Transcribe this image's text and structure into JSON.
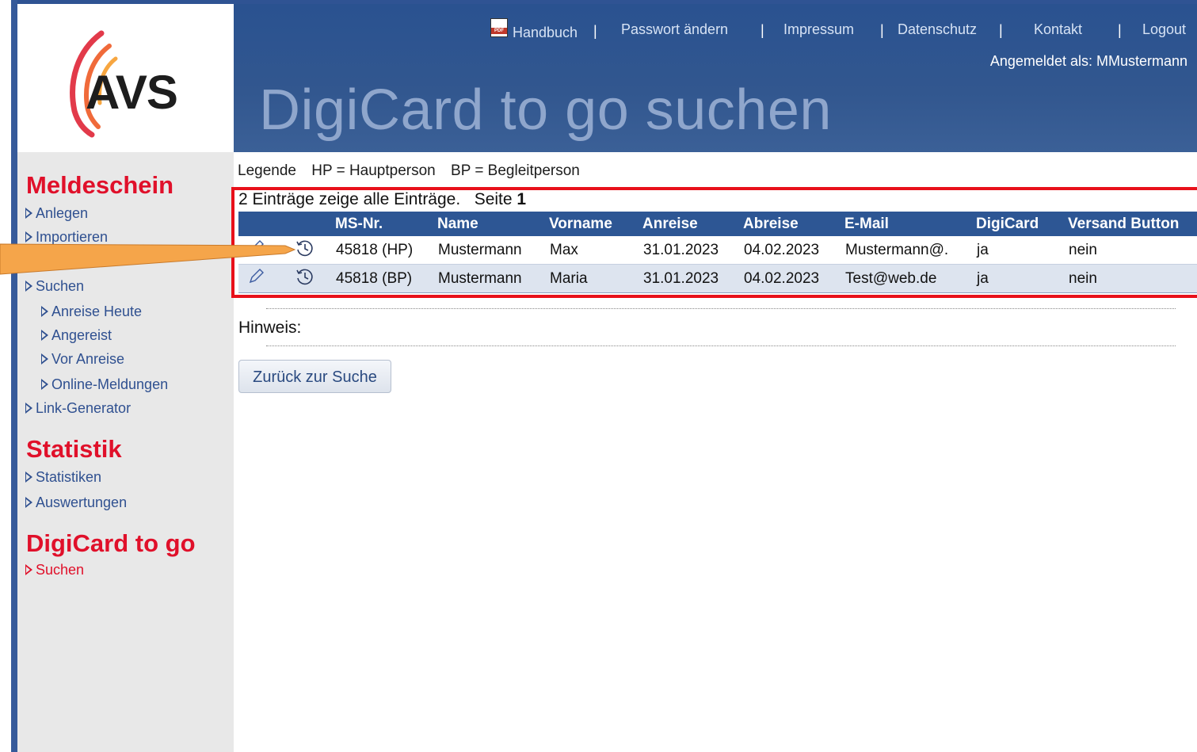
{
  "logo": {
    "text": "AVS"
  },
  "header": {
    "links": [
      "Handbuch",
      "Passwort ändern",
      "Impressum",
      "Datenschutz",
      "Kontakt",
      "Logout"
    ],
    "separator": "|",
    "logged_in": "Angemeldet als: MMustermann",
    "title": "DigiCard to go suchen"
  },
  "sidebar": {
    "sections": [
      {
        "heading": "Meldeschein",
        "items": [
          {
            "label": "Anlegen",
            "level": 0
          },
          {
            "label": "Importieren",
            "level": 0
          },
          {
            "label": "Suchen",
            "level": 0
          },
          {
            "label": "Anreise Heute",
            "level": 1
          },
          {
            "label": "Angereist",
            "level": 1
          },
          {
            "label": "Vor Anreise",
            "level": 1
          },
          {
            "label": "Online-Meldungen",
            "level": 1
          },
          {
            "label": "Link-Generator",
            "level": 0
          }
        ]
      },
      {
        "heading": "Statistik",
        "items": [
          {
            "label": "Statistiken",
            "level": 0
          },
          {
            "label": "Auswertungen",
            "level": 0
          }
        ]
      },
      {
        "heading": "DigiCard to go",
        "items": [
          {
            "label": "Suchen",
            "level": 0,
            "active": true
          }
        ]
      }
    ]
  },
  "legend": {
    "label": "Legende",
    "hp": "HP = Hauptperson",
    "bp": "BP = Begleitperson"
  },
  "results": {
    "count_text": "2 Einträge zeige alle Einträge.",
    "page_label": "Seite",
    "page_number": "1",
    "columns": [
      "",
      "",
      "MS-Nr.",
      "Name",
      "Vorname",
      "Anreise",
      "Abreise",
      "E-Mail",
      "DigiCard",
      "Versand Button"
    ],
    "rows": [
      [
        "45818 (HP)",
        "Mustermann",
        "Max",
        "31.01.2023",
        "04.02.2023",
        "Mustermann@.",
        "ja",
        "nein"
      ],
      [
        "45818 (BP)",
        "Mustermann",
        "Maria",
        "31.01.2023",
        "04.02.2023",
        "Test@web.de",
        "ja",
        "nein"
      ]
    ],
    "row_icons": [
      "pencil-icon",
      "history-icon"
    ]
  },
  "hint": {
    "label": "Hinweis:"
  },
  "back_button": {
    "label": "Zurück zur Suche"
  },
  "colors": {
    "header_blue": "#2a5290",
    "accent_red": "#e0102a",
    "highlight_red": "#e8101a",
    "sidebar_bg": "#e8e8e8",
    "callout_orange": "#f5a54a"
  }
}
